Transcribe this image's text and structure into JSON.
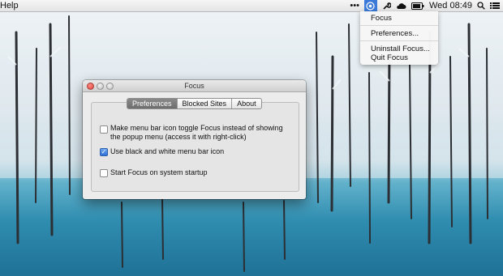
{
  "menubar": {
    "app_menu": "Help",
    "clock": "Wed 08:49",
    "icons": [
      "more-icon",
      "focus-icon",
      "wrench-icon",
      "cloud-icon",
      "battery-icon",
      "search-icon",
      "list-icon"
    ]
  },
  "dropdown": {
    "items": [
      "Focus",
      "Preferences...",
      "Uninstall Focus...",
      "Quit Focus"
    ]
  },
  "window": {
    "title": "Focus",
    "tabs": [
      {
        "label": "Preferences",
        "active": true
      },
      {
        "label": "Blocked Sites",
        "active": false
      },
      {
        "label": "About",
        "active": false
      }
    ],
    "options": [
      {
        "line1": "Make menu bar icon toggle Focus instead of showing",
        "line2": "the popup menu (access it with right-click)",
        "checked": false
      },
      {
        "line1": "Use black and white menu bar icon",
        "checked": true
      },
      {
        "line1": "Start Focus on system startup",
        "checked": false
      }
    ]
  },
  "colors": {
    "menubar_bg": "#e9e9e9",
    "menu_highlight": "#3b7ad9",
    "window_bg": "#ececec",
    "water": "#2f8db0"
  }
}
